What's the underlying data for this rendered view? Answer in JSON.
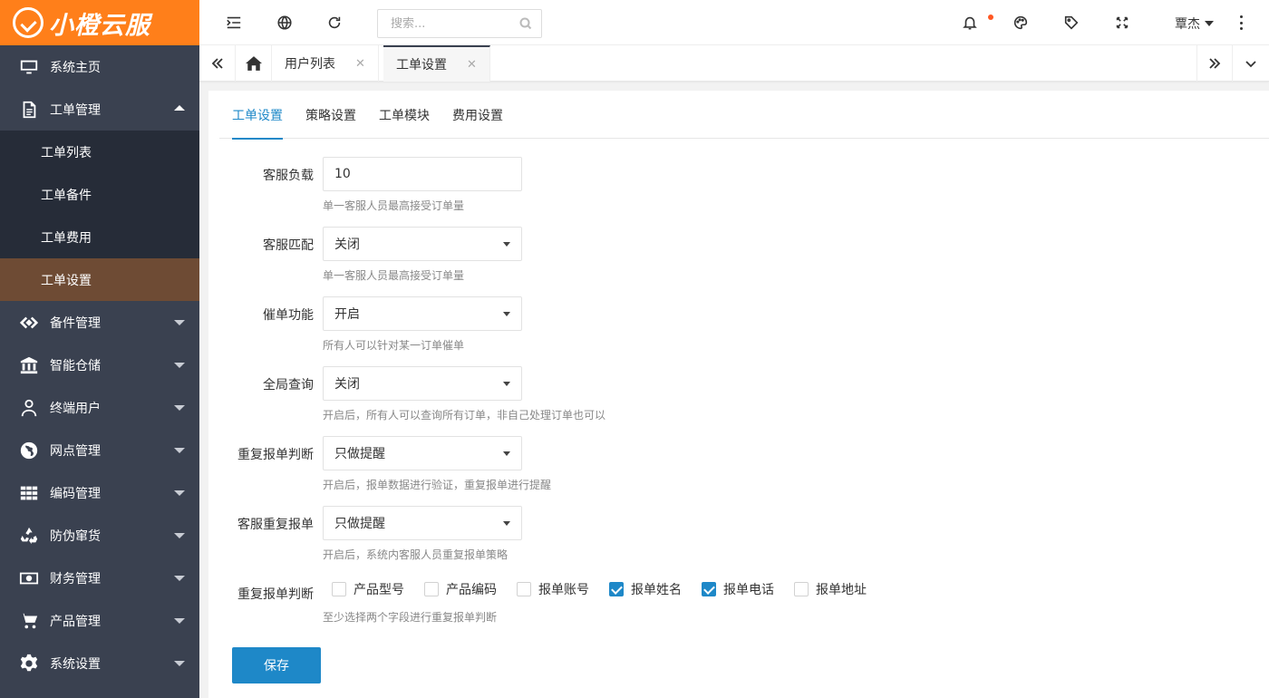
{
  "app": {
    "logo_text": "小橙云服"
  },
  "sidebar": {
    "items": [
      {
        "label": "系统主页",
        "icon": "monitor-icon"
      },
      {
        "label": "工单管理",
        "icon": "document-icon",
        "expanded": true,
        "children": [
          {
            "label": "工单列表"
          },
          {
            "label": "工单备件"
          },
          {
            "label": "工单费用"
          },
          {
            "label": "工单设置",
            "active": true
          }
        ]
      },
      {
        "label": "备件管理",
        "icon": "diamond-arrows-icon"
      },
      {
        "label": "智能仓储",
        "icon": "bank-icon"
      },
      {
        "label": "终端用户",
        "icon": "user-icon"
      },
      {
        "label": "网点管理",
        "icon": "globe-icon"
      },
      {
        "label": "编码管理",
        "icon": "grid-icon"
      },
      {
        "label": "防伪窜货",
        "icon": "recycle-icon"
      },
      {
        "label": "财务管理",
        "icon": "money-icon"
      },
      {
        "label": "产品管理",
        "icon": "cart-icon"
      },
      {
        "label": "系统设置",
        "icon": "gear-icon"
      }
    ]
  },
  "header": {
    "search_placeholder": "搜索...",
    "user_name": "覃杰",
    "accent": "#ff7f1a",
    "notification_dot_color": "#ff5722"
  },
  "tabs": [
    {
      "label": "用户列表"
    },
    {
      "label": "工单设置",
      "active": true
    }
  ],
  "subtabs": [
    {
      "label": "工单设置",
      "active": true
    },
    {
      "label": "策略设置"
    },
    {
      "label": "工单模块"
    },
    {
      "label": "费用设置"
    }
  ],
  "form": {
    "load": {
      "label": "客服负载",
      "value": "10",
      "hint": "单一客服人员最高接受订单量"
    },
    "match": {
      "label": "客服匹配",
      "value": "关闭",
      "hint": "单一客服人员最高接受订单量"
    },
    "urge": {
      "label": "催单功能",
      "value": "开启",
      "hint": "所有人可以针对某一订单催单"
    },
    "global_query": {
      "label": "全局查询",
      "value": "关闭",
      "hint": "开启后，所有人可以查询所有订单，非自己处理订单也可以"
    },
    "dup_check": {
      "label": "重复报单判断",
      "value": "只做提醒",
      "hint": "开启后，报单数据进行验证，重复报单进行提醒"
    },
    "cs_dup": {
      "label": "客服重复报单",
      "value": "只做提醒",
      "hint": "开启后，系统内客服人员重复报单策略"
    },
    "dup_fields": {
      "label": "重复报单判断",
      "hint": "至少选择两个字段进行重复报单判断",
      "options": [
        {
          "label": "产品型号",
          "checked": false
        },
        {
          "label": "产品编码",
          "checked": false
        },
        {
          "label": "报单账号",
          "checked": false
        },
        {
          "label": "报单姓名",
          "checked": true
        },
        {
          "label": "报单电话",
          "checked": true
        },
        {
          "label": "报单地址",
          "checked": false
        }
      ]
    },
    "save_label": "保存",
    "primary_color": "#1e88c8"
  }
}
